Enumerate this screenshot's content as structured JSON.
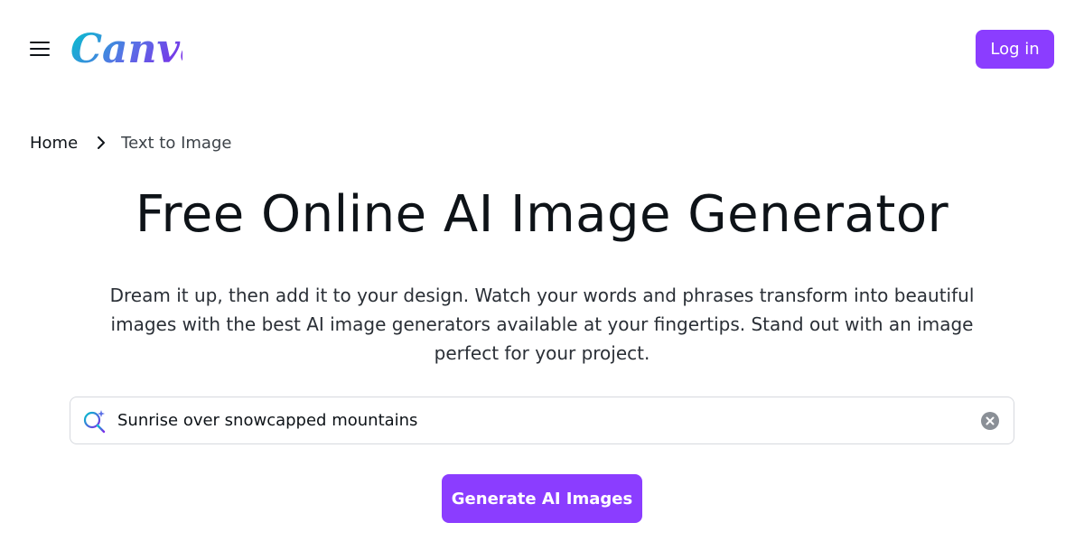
{
  "header": {
    "menu_icon": "hamburger-menu-icon",
    "logo_text": "Canva",
    "login_label": "Log in"
  },
  "breadcrumb": {
    "home": "Home",
    "separator_icon": "chevron-right-icon",
    "current": "Text to Image"
  },
  "hero": {
    "title": "Free Online AI Image Generator",
    "description": "Dream it up, then add it to your design. Watch your words and phrases transform into beautiful images with the best AI image generators available at your fingertips. Stand out with an image perfect for your project."
  },
  "search": {
    "icon": "magic-search-icon",
    "value": "Sunrise over snowcapped mountains",
    "clear_icon": "clear-circle-icon"
  },
  "cta": {
    "label": "Generate AI Images"
  },
  "colors": {
    "accent": "#8b3dff",
    "logo_gradient_start": "#00c4cc",
    "logo_gradient_end": "#7d2ae8",
    "text_primary": "#0e1318"
  }
}
